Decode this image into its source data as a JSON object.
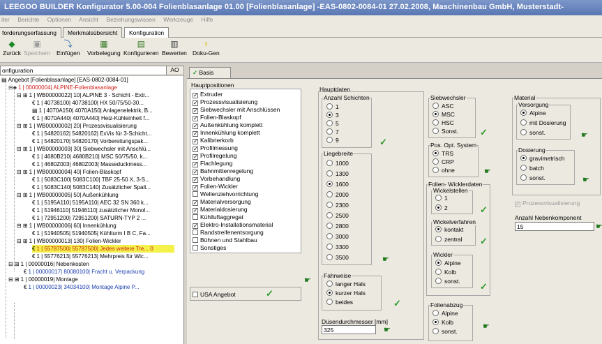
{
  "title": "LEEGOO BUILDER  Konfigurator 5.00-004 Folienblasanlage 01.00 [Folienblasanlage] -EAS-0802-0084-01 27.02.2008, Maschinenbau GmbH, Musterstadt-",
  "menu": [
    "iter",
    "Berichte",
    "Optionen",
    "Ansicht",
    "Beziehungswissen",
    "Werkzeuge",
    "Hilfe"
  ],
  "tabs": [
    "forderungserfassung",
    "Merkmalsübersicht",
    "Konfiguration"
  ],
  "toolbar": {
    "zurueck": "Zurück",
    "speichern": "Speichern",
    "einfuegen": "Einfügen",
    "vorbelegung": "Vorbelegung",
    "konfigurieren": "Konfigurieren",
    "bewerten": "Bewerten",
    "dokugen": "Doku-Gen"
  },
  "tree_header": {
    "label": "onfiguration",
    "code": "AO"
  },
  "tree": [
    "Angebot [Folienblasanlage] [EAS-0802-0084-01]",
    "1 | 00000004| ALPINE-Folienblasanlage",
    "1 | WB00000022| 10| ALPINE 3 - Schicht - Extr...",
    "1 | 40738100| 40738100| HX 50/75/50-30...",
    "1 | 4070A150| 4070A150| Anlagenelektrik, B...",
    "1 | 4070A440| 4070A440| Heiz-Kühleinheit f...",
    "1 | WB00000002| 20| Prozessvisualisierung",
    "1 | 54820162| 54820162| ExVis für 3-Schicht...",
    "1 | 54820170| 54820170| Vorbereitungspak...",
    "1 | WB00000003| 30| Siebwechsler mit Anschlü...",
    "1 | 4680B210| 4680B210| MSC 50/75/50, k...",
    "1 | 4680Z003| 4680Z003| Masseduckmess...",
    "1 | WB00000004| 40| Folien-Blaskopf",
    "1 | 5083C100| 5083C100| TBF 25-50 X, 3-S...",
    "1 | 5083C140| 5083C140| Zusätzlicher Spalt...",
    "1 | WB00000005| 50| Außenkühlung",
    "1 | 5195A110| 5195A110| AEC 32 SN 360 k...",
    "1 | 51946110| 51946110| zusätzlicher Monol...",
    "1 | 72951200| 72951200| SATURN-TYP 2 ...",
    "1 | WB00000006| 60| Innenkühlung",
    "1 | 51940505| 51940505| Kühlturm I B C, Fa...",
    "1 | WB00000013| 130| Folien-Wickler",
    "1 | 55787500| 55787500| Jedes weitere Tre...  0",
    "1 | 55776213| 55776213| Mehrpreis für Wic...",
    "1 | 00000016| Nebenkosten",
    "1 | 00000017| 80080100| Fracht u. Verpackung",
    "1 | 00000019| Montage",
    "1 | 00000023| 34034100| Montage Alpine P..."
  ],
  "basis_tab": "Basis",
  "hauptpositionen": {
    "label": "Hauptpositionen",
    "items": [
      {
        "label": "Extruder",
        "checked": true
      },
      {
        "label": "Prozessvisualisierung",
        "checked": true
      },
      {
        "label": "Siebwechsler mit Anschlüssen",
        "checked": true
      },
      {
        "label": "Folien-Blaskopf",
        "checked": true
      },
      {
        "label": "Außenkühlung komplett",
        "checked": true
      },
      {
        "label": "Innenkühlung komplett",
        "checked": true
      },
      {
        "label": "Kalibrierkorb",
        "checked": true
      },
      {
        "label": "Profilmessung",
        "checked": true
      },
      {
        "label": "Profilregelung",
        "checked": true
      },
      {
        "label": "Flachlegung",
        "checked": true
      },
      {
        "label": "Bahnmittenregelung",
        "checked": true
      },
      {
        "label": "Vorbehandlung",
        "checked": true
      },
      {
        "label": "Folien-Wickler",
        "checked": true
      },
      {
        "label": "Wellenziehvorrichtung",
        "checked": false
      },
      {
        "label": "Materialversorgung",
        "checked": true
      },
      {
        "label": "Materialdosierung",
        "checked": true
      },
      {
        "label": "Kühlluftaggregat",
        "checked": false
      },
      {
        "label": "Elektro-Installationsmaterial",
        "checked": true
      },
      {
        "label": "Randstreifenentsorgung",
        "checked": false
      },
      {
        "label": "Bühnen und Stahlbau",
        "checked": false
      },
      {
        "label": "Sonstiges",
        "checked": false
      }
    ]
  },
  "usa_angebot": "USA Angebot",
  "hauptdaten": "Hauptdaten",
  "anzahl_schichten": {
    "label": "Anzahl Schichten",
    "options": [
      "1",
      "3",
      "5",
      "7",
      "9"
    ],
    "selected": "3"
  },
  "liegebreite": {
    "label": "Liegebreite",
    "options": [
      "1000",
      "1300",
      "1600",
      "2000",
      "2300",
      "2500",
      "2800",
      "3000",
      "3300",
      "3500"
    ],
    "selected": "1600"
  },
  "fahrweise": {
    "label": "Fahrweise",
    "options": [
      "langer Hals",
      "kurzer Hals",
      "beides"
    ],
    "selected": "kurzer Hals"
  },
  "duesendurchmesser": {
    "label": "Düsendurchmesser [mm]",
    "value": "325"
  },
  "siebwechsler": {
    "label": "Siebwechsler",
    "options": [
      "ASC",
      "MSC",
      "HSC",
      "Sonst."
    ],
    "selected": "MSC"
  },
  "pos_opt_system": {
    "label": "Pos. Opt. System",
    "options": [
      "TRS",
      "CRP",
      "ohne"
    ],
    "selected": "TRS"
  },
  "folien_wicklerdaten": "Folien- Wicklerdaten",
  "wickelstellen": {
    "label": "Wickelstellen",
    "options": [
      "1",
      "2"
    ],
    "selected": "2"
  },
  "wickelverfahren": {
    "label": "Wickelverfahren",
    "options": [
      "kontakt",
      "zentral"
    ],
    "selected": "kontakt"
  },
  "wickler": {
    "label": "Wickler",
    "options": [
      "Alpine",
      "Kolb",
      "sonst."
    ],
    "selected": "Alpine"
  },
  "folienabzug": {
    "label": "Folienabzug",
    "options": [
      "Alpine",
      "Kolb",
      "sonst."
    ],
    "selected": "Kolb"
  },
  "material": "Material",
  "versorgung": {
    "label": "Versorgung",
    "options": [
      "Alpine",
      "mit Dosierung",
      "sonst."
    ],
    "selected": "Alpine"
  },
  "dosierung": {
    "label": "Dosierung",
    "options": [
      "gravimetrisch",
      "batch",
      "sonst."
    ],
    "selected": "gravimetrisch"
  },
  "prozessvisualisierung_chk": "Prozessvisualisierung",
  "anzahl_nebenkomponent": {
    "label": "Anzahl Nebenkomponent",
    "value": "15"
  }
}
